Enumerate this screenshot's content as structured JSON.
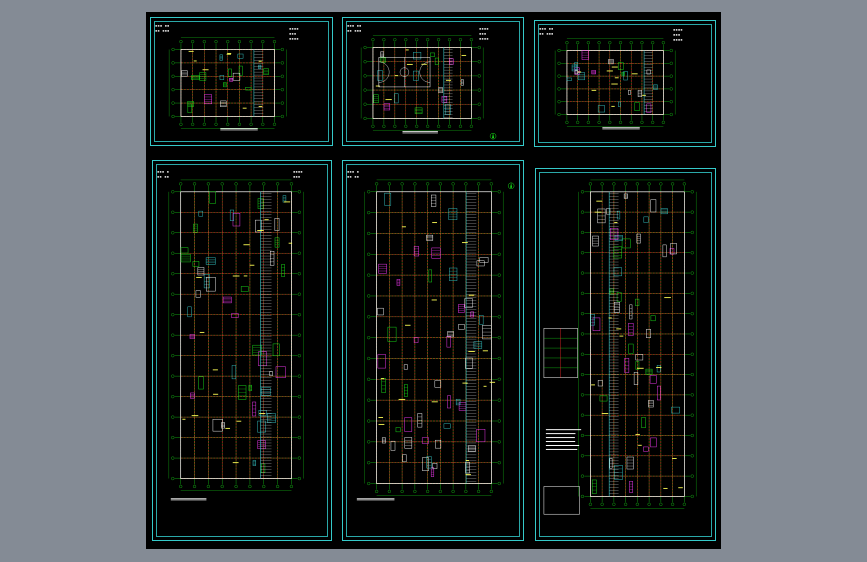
{
  "viewport": {
    "background": "#848b95",
    "canvas_bg": "#000000",
    "frame_color": "#35c9c9"
  },
  "colors": {
    "axis_grid": "#19e619",
    "walls": "#ff2a2a",
    "detail": "#ffffff",
    "accent_cyan": "#35c9c9",
    "accent_magenta": "#ff3cff",
    "accent_yellow": "#ffff55"
  },
  "sheets": [
    {
      "id": "sheet-1",
      "kind": "floor-plan-small",
      "caption": "",
      "has_court": false
    },
    {
      "id": "sheet-2",
      "kind": "floor-plan-small",
      "caption": "",
      "has_court": true
    },
    {
      "id": "sheet-3",
      "kind": "floor-plan-small",
      "caption": "",
      "has_court": false
    },
    {
      "id": "sheet-4",
      "kind": "floor-plan-tall",
      "caption": "",
      "has_court": false
    },
    {
      "id": "sheet-5",
      "kind": "floor-plan-tall",
      "caption": "",
      "has_court": false
    },
    {
      "id": "sheet-6",
      "kind": "floor-plan-tall",
      "caption": "",
      "has_court": false
    }
  ],
  "icons": [
    "north-arrow-icon",
    "basketball-court-icon",
    "section-marker-icon"
  ]
}
